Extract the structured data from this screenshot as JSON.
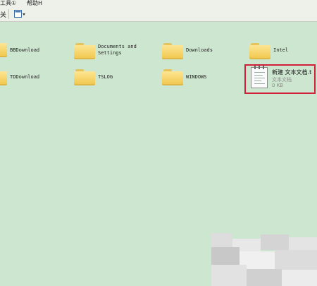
{
  "menubar": {
    "tools": "工具①",
    "help": "帮助H"
  },
  "toolbar": {
    "close_label": "关"
  },
  "folders": [
    {
      "name": "BBDownload"
    },
    {
      "name": "Documents and\nSettings"
    },
    {
      "name": "Downloads"
    },
    {
      "name": "Intel"
    },
    {
      "name": "TDDownload"
    },
    {
      "name": "TSLOG"
    },
    {
      "name": "WINDOWS"
    }
  ],
  "selected_file": {
    "name": "新建 文本文档.t",
    "type": "文本文档",
    "size": "0 KB"
  },
  "colors": {
    "background": "#cde6cf",
    "selection_border": "#d0203a"
  }
}
